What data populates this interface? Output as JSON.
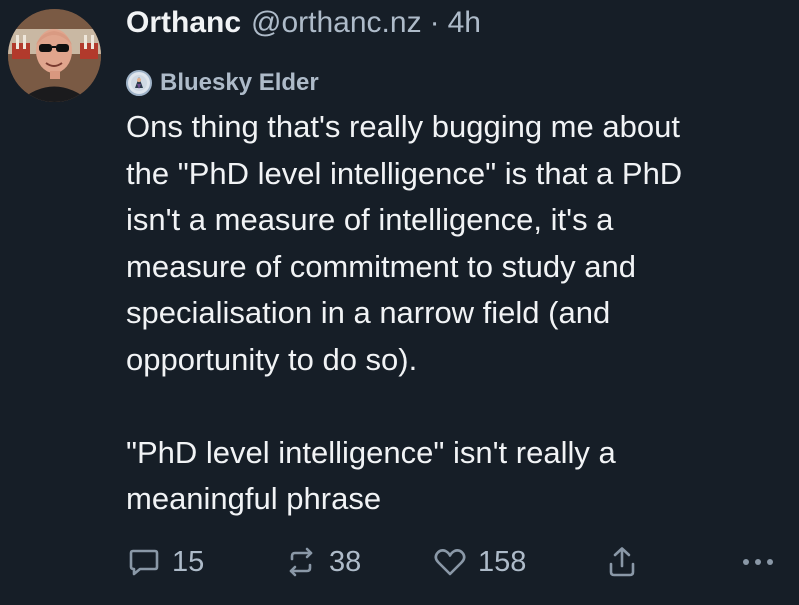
{
  "post": {
    "author": {
      "display_name": "Orthanc",
      "handle": "@orthanc.nz",
      "separator": "·",
      "time_ago": "4h"
    },
    "badge": {
      "label": "Bluesky Elder",
      "icon": "bluesky-elder-badge-icon"
    },
    "text": "Ons thing that's really bugging me about\nthe \"PhD level intelligence\" is that a PhD\nisn't a measure of intelligence, it's a\nmeasure of commitment to study and\nspecialisation in a narrow field (and\nopportunity to do so).\n\n\"PhD level intelligence\" isn't really a\nmeaningful phrase",
    "actions": {
      "reply_count": "15",
      "repost_count": "38",
      "like_count": "158"
    }
  },
  "colors": {
    "background": "#161e27",
    "text_primary": "#f1f3f5",
    "text_secondary": "#aebbc9",
    "icon": "#8a98a7"
  }
}
